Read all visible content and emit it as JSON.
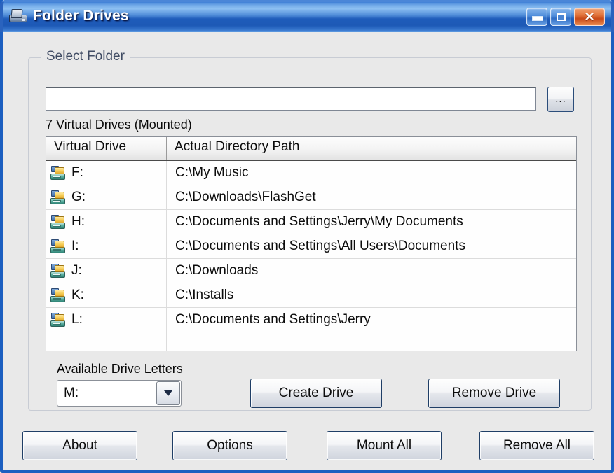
{
  "window": {
    "title": "Folder Drives",
    "app_icon": "folder-drive-icon",
    "controls": {
      "minimize": "minimize-button",
      "maximize": "maximize-button",
      "close_glyph": "✕"
    }
  },
  "group": {
    "label": "Select Folder"
  },
  "path_field": {
    "value": "",
    "placeholder": ""
  },
  "browse_button": {
    "label": "..."
  },
  "list": {
    "count_label": "7 Virtual Drives (Mounted)",
    "columns": [
      "Virtual Drive",
      "Actual Directory Path"
    ],
    "rows": [
      {
        "drive": "F:",
        "path": "C:\\My Music"
      },
      {
        "drive": "G:",
        "path": "C:\\Downloads\\FlashGet"
      },
      {
        "drive": "H:",
        "path": "C:\\Documents and Settings\\Jerry\\My Documents"
      },
      {
        "drive": "I:",
        "path": "C:\\Documents and Settings\\All Users\\Documents"
      },
      {
        "drive": "J:",
        "path": "C:\\Downloads"
      },
      {
        "drive": "K:",
        "path": "C:\\Installs"
      },
      {
        "drive": "L:",
        "path": "C:\\Documents and Settings\\Jerry"
      }
    ]
  },
  "drive_letters": {
    "label": "Available Drive Letters",
    "selected": "M:"
  },
  "actions": {
    "create_drive": "Create Drive",
    "remove_drive": "Remove Drive",
    "about": "About",
    "options": "Options",
    "mount_all": "Mount All",
    "remove_all": "Remove All"
  },
  "colors": {
    "titlebar_blue": "#1f5cba",
    "close_orange": "#c84a18",
    "client_background": "#e9e9e9",
    "list_background": "#ffffff"
  }
}
